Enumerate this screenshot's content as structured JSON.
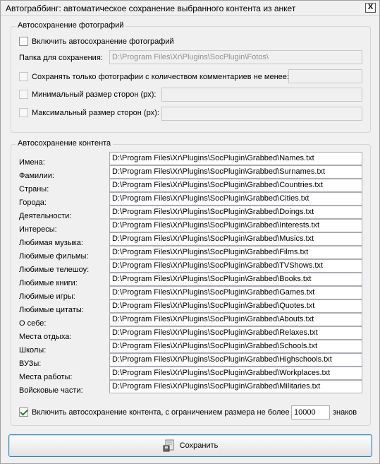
{
  "window": {
    "title": "Автограббинг: автоматическое сохранение выбранного контента из анкет",
    "close_label": "X"
  },
  "photos": {
    "group_title": "Автосохранение фотографий",
    "enable_label": "Включить автосохранение фотографий",
    "enable_checked": false,
    "folder_label": "Папка для сохранения:",
    "folder_value": "D:\\Program Files\\Xr\\Plugins\\SocPlugin\\Fotos\\",
    "comments_label": "Сохранять только фотографии с количеством комментариев не менее:",
    "comments_value": "",
    "min_size_label": "Минимальный размер сторон (px):",
    "min_size_value": "",
    "max_size_label": "Максимальный размер сторон (px):",
    "max_size_value": ""
  },
  "content": {
    "group_title": "Автосохранение контента",
    "rows": [
      {
        "label": "Имена:",
        "path": "D:\\Program Files\\Xr\\Plugins\\SocPlugin\\Grabbed\\Names.txt"
      },
      {
        "label": "Фамилии:",
        "path": "D:\\Program Files\\Xr\\Plugins\\SocPlugin\\Grabbed\\Surnames.txt"
      },
      {
        "label": "Страны:",
        "path": "D:\\Program Files\\Xr\\Plugins\\SocPlugin\\Grabbed\\Countries.txt"
      },
      {
        "label": "Города:",
        "path": "D:\\Program Files\\Xr\\Plugins\\SocPlugin\\Grabbed\\Cities.txt"
      },
      {
        "label": "Деятельности:",
        "path": "D:\\Program Files\\Xr\\Plugins\\SocPlugin\\Grabbed\\Doings.txt"
      },
      {
        "label": "Интересы:",
        "path": "D:\\Program Files\\Xr\\Plugins\\SocPlugin\\Grabbed\\Interests.txt"
      },
      {
        "label": "Любимая музыка:",
        "path": "D:\\Program Files\\Xr\\Plugins\\SocPlugin\\Grabbed\\Musics.txt"
      },
      {
        "label": "Любимые фильмы:",
        "path": "D:\\Program Files\\Xr\\Plugins\\SocPlugin\\Grabbed\\Films.txt"
      },
      {
        "label": "Любимые телешоу:",
        "path": "D:\\Program Files\\Xr\\Plugins\\SocPlugin\\Grabbed\\TVShows.txt"
      },
      {
        "label": "Любимые книги:",
        "path": "D:\\Program Files\\Xr\\Plugins\\SocPlugin\\Grabbed\\Books.txt"
      },
      {
        "label": "Любимые игры:",
        "path": "D:\\Program Files\\Xr\\Plugins\\SocPlugin\\Grabbed\\Games.txt"
      },
      {
        "label": "Любимые цитаты:",
        "path": "D:\\Program Files\\Xr\\Plugins\\SocPlugin\\Grabbed\\Quotes.txt"
      },
      {
        "label": "О себе:",
        "path": "D:\\Program Files\\Xr\\Plugins\\SocPlugin\\Grabbed\\Abouts.txt"
      },
      {
        "label": "Места отдыха:",
        "path": "D:\\Program Files\\Xr\\Plugins\\SocPlugin\\Grabbed\\Relaxes.txt"
      },
      {
        "label": "Школы:",
        "path": "D:\\Program Files\\Xr\\Plugins\\SocPlugin\\Grabbed\\Schools.txt"
      },
      {
        "label": "ВУЗы:",
        "path": "D:\\Program Files\\Xr\\Plugins\\SocPlugin\\Grabbed\\Highschools.txt"
      },
      {
        "label": "Места работы:",
        "path": "D:\\Program Files\\Xr\\Plugins\\SocPlugin\\Grabbed\\Workplaces.txt"
      },
      {
        "label": "Войсковые части:",
        "path": "D:\\Program Files\\Xr\\Plugins\\SocPlugin\\Grabbed\\Militaries.txt"
      }
    ],
    "limit_label": "Включить автосохранение контента, с ограничением размера не более",
    "limit_checked": true,
    "limit_value": "10000",
    "limit_unit": "знаков"
  },
  "actions": {
    "save_label": "Сохранить",
    "save_icon": "save-icon"
  }
}
